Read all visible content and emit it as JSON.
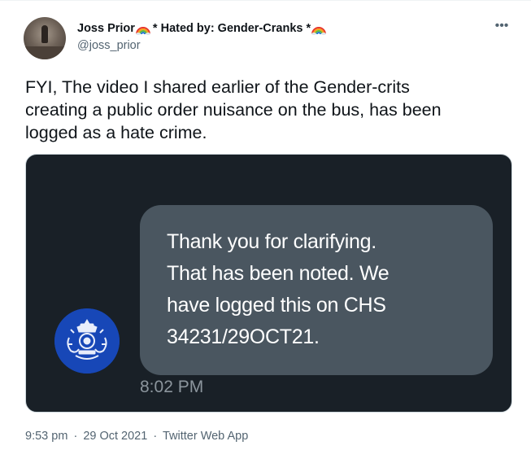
{
  "tweet": {
    "author": {
      "display_name_part1": "Joss Prior",
      "display_name_part2": "* Hated by: Gender-Cranks *",
      "emoji_icon": "rainbow-icon",
      "handle": "@joss_prior"
    },
    "more_icon": "more-options-icon",
    "more_glyph": "•••",
    "text_lines": [
      "FYI, The video I shared earlier of the Gender-crits",
      "creating a public order nuisance on the bus, has been",
      "logged as a hate crime."
    ],
    "media": {
      "message_lines": [
        "Thank you for clarifying.",
        "That has been noted.  We",
        "have logged this on CHS",
        "34231/29OCT21."
      ],
      "message_time": "8:02 PM",
      "sender_logo_icon": "police-crest-icon",
      "colors": {
        "background": "#192027",
        "bubble": "#4a5660",
        "logo": "#1747b7"
      }
    },
    "time": "9:53 pm",
    "date": "29 Oct 2021",
    "source": "Twitter Web App",
    "separator": "·"
  }
}
